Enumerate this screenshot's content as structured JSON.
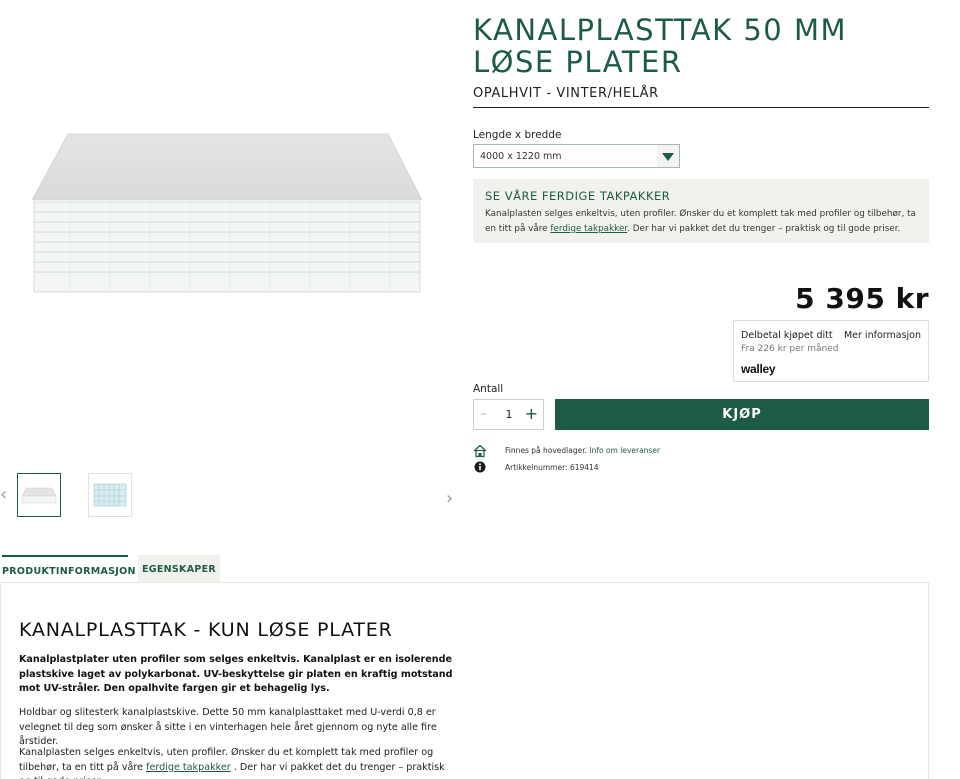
{
  "product": {
    "title": "KANALPLASTTAK 50 MM LØSE PLATER",
    "subtitle": "OPALHVIT - VINTER/HELÅR",
    "size_label": "Lengde x bredde",
    "size_value": "4000 x 1220 mm",
    "price": "5 395 kr"
  },
  "promo": {
    "title": "SE VÅRE FERDIGE TAKPAKKER",
    "text_before": "Kanalplasten selges enkeltvis, uten profiler. Ønsker du et komplett tak med profiler og tilbehør, ta en titt på våre ",
    "link": "ferdige takpakker",
    "text_after": ". Der har vi pakket det du trenger – praktisk og til gode priser."
  },
  "walley": {
    "title": "Delbetal kjøpet ditt",
    "more": "Mer informasjon",
    "sub": "Fra 226 kr per måned",
    "logo": "walley"
  },
  "purchase": {
    "qty_label": "Antall",
    "qty_minus": "–",
    "qty_value": "1",
    "qty_plus": "+",
    "buy_label": "KJØP"
  },
  "availability": {
    "text": "Finnes på hovedlager.",
    "link": "Info om leveranser"
  },
  "article": {
    "text": "Artikkelnummer: 619414"
  },
  "gallery": {
    "prev": "‹",
    "next": "›"
  },
  "tabs": [
    {
      "label": "PRODUKTINFORMASJON"
    },
    {
      "label": "EGENSKAPER"
    }
  ],
  "content": {
    "title": "KANALPLASTTAK - KUN LØSE PLATER",
    "p1": "Kanalplastplater uten profiler som selges enkeltvis. Kanalplast er en isolerende plastskive laget av polykarbonat. UV-beskyttelse gir platen en kraftig motstand mot UV-stråler. Den opalhvite fargen gir et behagelig lys.",
    "p2": "Holdbar og slitesterk kanalplastskive. Dette 50 mm kanalplasttaket med U-verdi 0,8 er velegnet til deg som ønsker å sitte i en vinterhagen hele året gjennom og nyte alle fire årstider.",
    "p3_before": "Kanalplasten selges enkeltvis, uten profiler. Ønsker du et komplett tak med profiler og tilbehør, ta en titt på våre ",
    "p3_link": "ferdige takpakker",
    "p3_after": " . Der har vi pakket det du trenger – praktisk og til gode priser."
  },
  "colors": {
    "brand_green": "#1e5b45",
    "promo_bg": "#f1f2ed"
  },
  "icons": [
    "chevron-left-icon",
    "chevron-right-icon",
    "dropdown-arrow-icon",
    "warehouse-icon",
    "info-icon"
  ]
}
